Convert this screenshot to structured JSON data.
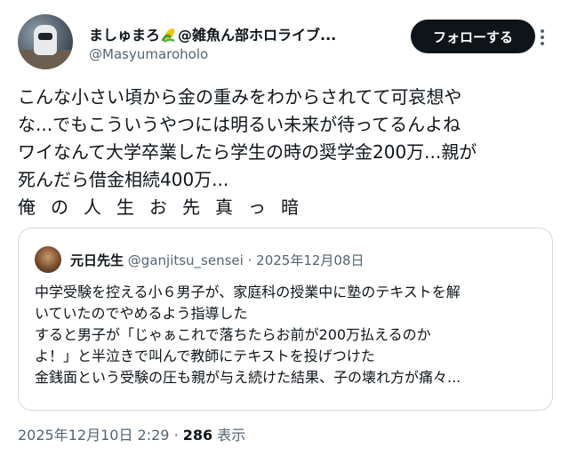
{
  "author": {
    "name_prefix": "ましゅまろ",
    "badge_icon": "corn-emoji-icon",
    "name_suffix": "@雑魚ん部ホロライブ...",
    "handle": "@Masyumaroholo"
  },
  "follow_button": {
    "label": "フォローする"
  },
  "more_icon": "more-options-icon",
  "tweet": {
    "lines": [
      "こんな小さい頃から金の重みをわからされてて可哀想や",
      "な...でもこういうやつには明るい未来が待ってるんよね",
      "ワイなんて大学卒業したら学生の時の奨学金200万...親が",
      "死んだら借金相続400万...",
      "俺の人生お先真っ暗"
    ]
  },
  "quote": {
    "name": "元日先生",
    "handle": "@ganjitsu_sensei",
    "separator": "·",
    "date": "2025年12月08日",
    "lines": [
      "中学受験を控える小６男子が、家庭科の授業中に塾のテキストを解",
      "いていたのでやめるよう指導した",
      "すると男子が「じゃぁこれで落ちたらお前が200万払えるのか",
      "よ！」と半泣きで叫んで教師にテキストを投げつけた",
      "金銭面という受験の圧も親が与え続けた結果、子の壊れ方が痛々..."
    ]
  },
  "footer": {
    "timestamp": "2025年12月10日 2:29",
    "separator": "·",
    "views_count": "286",
    "views_label": "表示"
  },
  "colors": {
    "text": "#0f1419",
    "secondary": "#536471",
    "border": "#cfd9de",
    "button_bg": "#0f1419"
  }
}
